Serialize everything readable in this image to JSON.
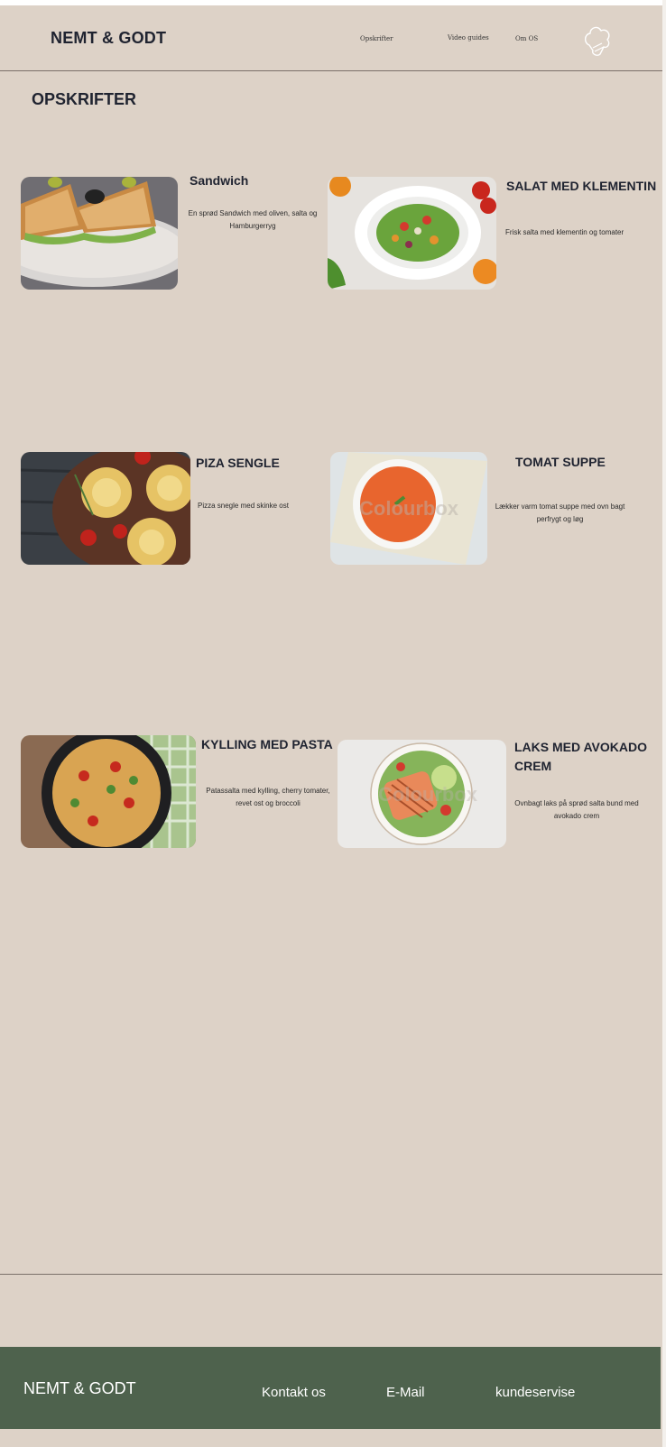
{
  "header": {
    "logo": "NEMT & GODT",
    "nav": [
      "Opskrifter",
      "Video guides",
      "Om OS"
    ],
    "icon": "chef-hat-icon"
  },
  "page_title": "OPSKRIFTER",
  "recipes": [
    {
      "title": "Sandwich",
      "desc": "En sprød Sandwich  med oliven, salta og Hamburgerryg"
    },
    {
      "title": "SALAT MED KLEMENTIN",
      "desc": "Frisk salta med klementin og tomater"
    },
    {
      "title": "PIZA SENGLE",
      "desc": "Pizza snegle med skinke ost"
    },
    {
      "title": "TOMAT SUPPE",
      "desc": "Lækker  varm tomat suppe med ovn bagt perfrygt og løg"
    },
    {
      "title": "KYLLING MED PASTA",
      "desc": "Patassalta med kylling, cherry tomater, revet ost og broccoli"
    },
    {
      "title": "LAKS MED AVOKADO CREM",
      "desc": "Ovnbagt laks på sprød salta bund med avokado crem"
    }
  ],
  "watermark": "Colourbox",
  "footer": {
    "logo": "NEMT & GODT",
    "links": [
      "Kontakt os",
      "E-Mail",
      "kundeservise"
    ]
  },
  "colors": {
    "background": "#ddd2c7",
    "footer": "#4e624d",
    "text": "#1f2330"
  }
}
